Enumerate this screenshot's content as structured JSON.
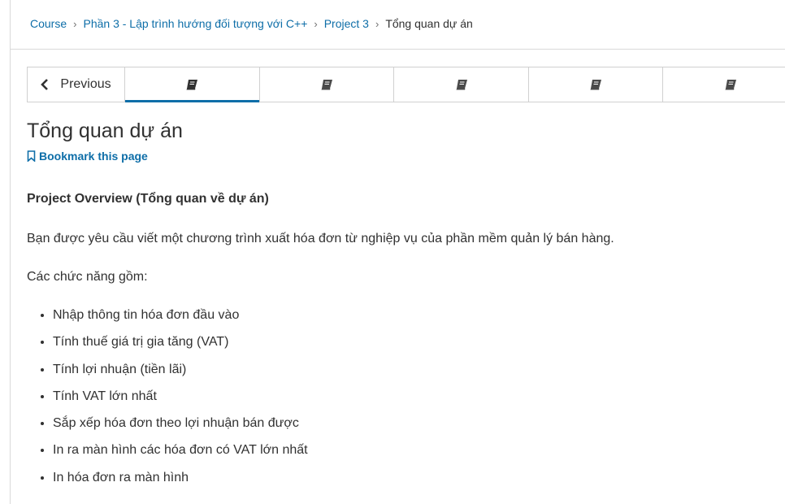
{
  "breadcrumb": {
    "items": [
      "Course",
      "Phần 3 - Lập trình hướng đối tượng với C++",
      "Project 3"
    ],
    "current": "Tổng quan dự án"
  },
  "sequence_nav": {
    "previous_label": "Previous",
    "tab_icon": "book-icon",
    "active_tab_index": 0
  },
  "page": {
    "title": "Tổng quan dự án",
    "bookmark_label": "Bookmark this page"
  },
  "content": {
    "heading": "Project Overview (Tổng quan về dự án)",
    "intro": "Bạn được yêu cầu viết một chương trình xuất hóa đơn từ nghiệp vụ của phần mềm quản lý bán hàng.",
    "features_intro": "Các chức năng gồm:",
    "features": [
      "Nhập thông tin hóa đơn đầu vào",
      "Tính thuế giá trị gia tăng (VAT)",
      "Tính lợi nhuận (tiền lãi)",
      "Tính VAT lớn nhất",
      "Sắp xếp hóa đơn theo lợi nhuận bán được",
      "In ra màn hình các hóa đơn có VAT lớn nhất",
      "In hóa đơn ra màn hình"
    ]
  },
  "colors": {
    "link": "#0e6ea8",
    "text": "#313131",
    "border": "#d0d0d0"
  }
}
